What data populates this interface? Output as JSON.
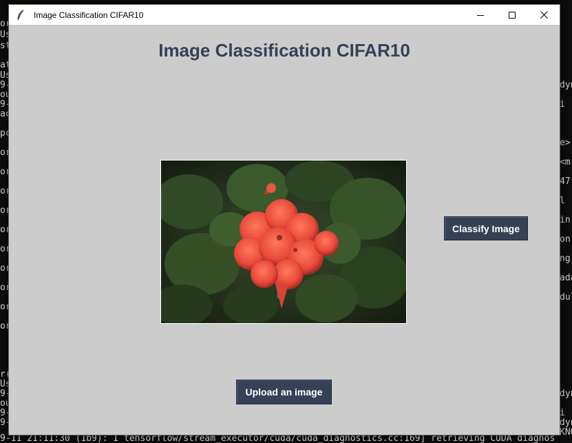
{
  "window": {
    "title": "Image Classification CIFAR10",
    "controls": [
      "minimize",
      "maximize",
      "close"
    ]
  },
  "app": {
    "heading": "Image Classification CIFAR10",
    "image_description_icon": "photo-red-geranium-flower",
    "classify_button": "Classify Image",
    "upload_button": "Upload an image"
  },
  "console": {
    "left_fragments": [
      "or",
      "Us",
      "st",
      "at",
      "Us",
      "9-",
      "ou",
      "9-",
      "ac",
      "pc",
      "or",
      "or",
      "or",
      "or",
      "or",
      "or",
      "or",
      "or",
      "or",
      "or",
      "r(",
      "Us",
      "9-",
      "ou",
      "9-",
      "9-"
    ],
    "right_fragments": [
      "dyn",
      "i",
      "e>",
      "<m",
      "47",
      "l",
      "in",
      "on",
      "ng",
      "ada",
      "dul",
      "dyn",
      "i",
      "dyn",
      "KNO"
    ],
    "bottom_line": "9-11 21:11:30 (1b9): I tensorflow/stream_executor/cuda/cuda_diagnostics.cc:169] retrieving CUDA diagnos"
  },
  "colors": {
    "heading": "#364156",
    "button_bg": "#364156",
    "button_text": "#ffffff",
    "window_bg": "#cccccc"
  }
}
